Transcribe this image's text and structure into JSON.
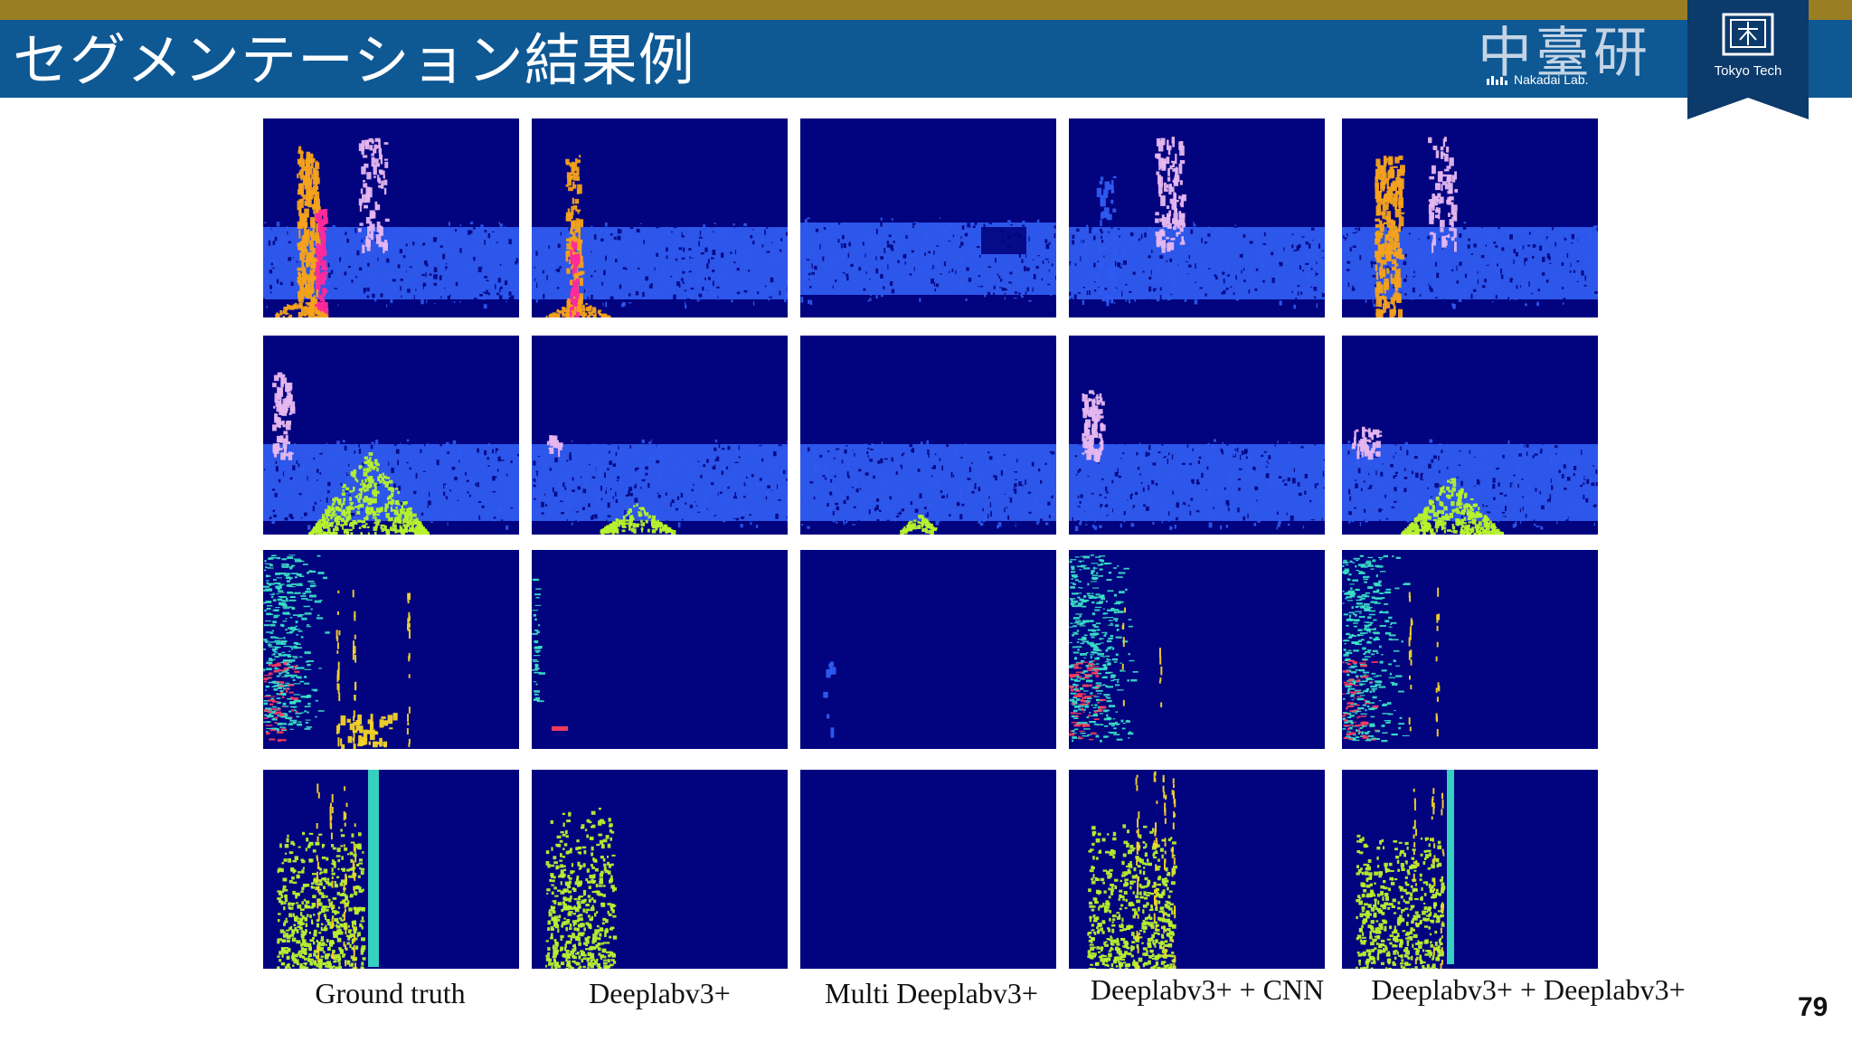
{
  "slide": {
    "title": "セグメンテーション結果例",
    "page_number": "79"
  },
  "lab_logo": {
    "kanji": "中臺研",
    "subtitle": "Nakadai Lab."
  },
  "university_logo": {
    "name": "Tokyo Tech"
  },
  "colors": {
    "top_bar": "#9a7e23",
    "header": "#0e5894",
    "background_class": "#02037f",
    "noise_class": "#2f5bf0",
    "orange_class": "#f4a21c",
    "magenta_class": "#ff2a9a",
    "lilac_class": "#e6b7ef",
    "green_class": "#b6f12e",
    "cyan_class": "#3ce5c8",
    "red_class": "#ff3c5a",
    "yellow_class": "#f4d42a"
  },
  "columns": [
    {
      "label": "Ground truth"
    },
    {
      "label": "Deeplabv3+"
    },
    {
      "label": "Multi Deeplabv3+"
    },
    {
      "label": "Deeplabv3+ + CNN"
    },
    {
      "label": "Deeplabv3+ + Deeplabv3+"
    }
  ],
  "rows": [
    {
      "name": "example-1"
    },
    {
      "name": "example-2"
    },
    {
      "name": "example-3"
    },
    {
      "name": "example-4"
    }
  ]
}
